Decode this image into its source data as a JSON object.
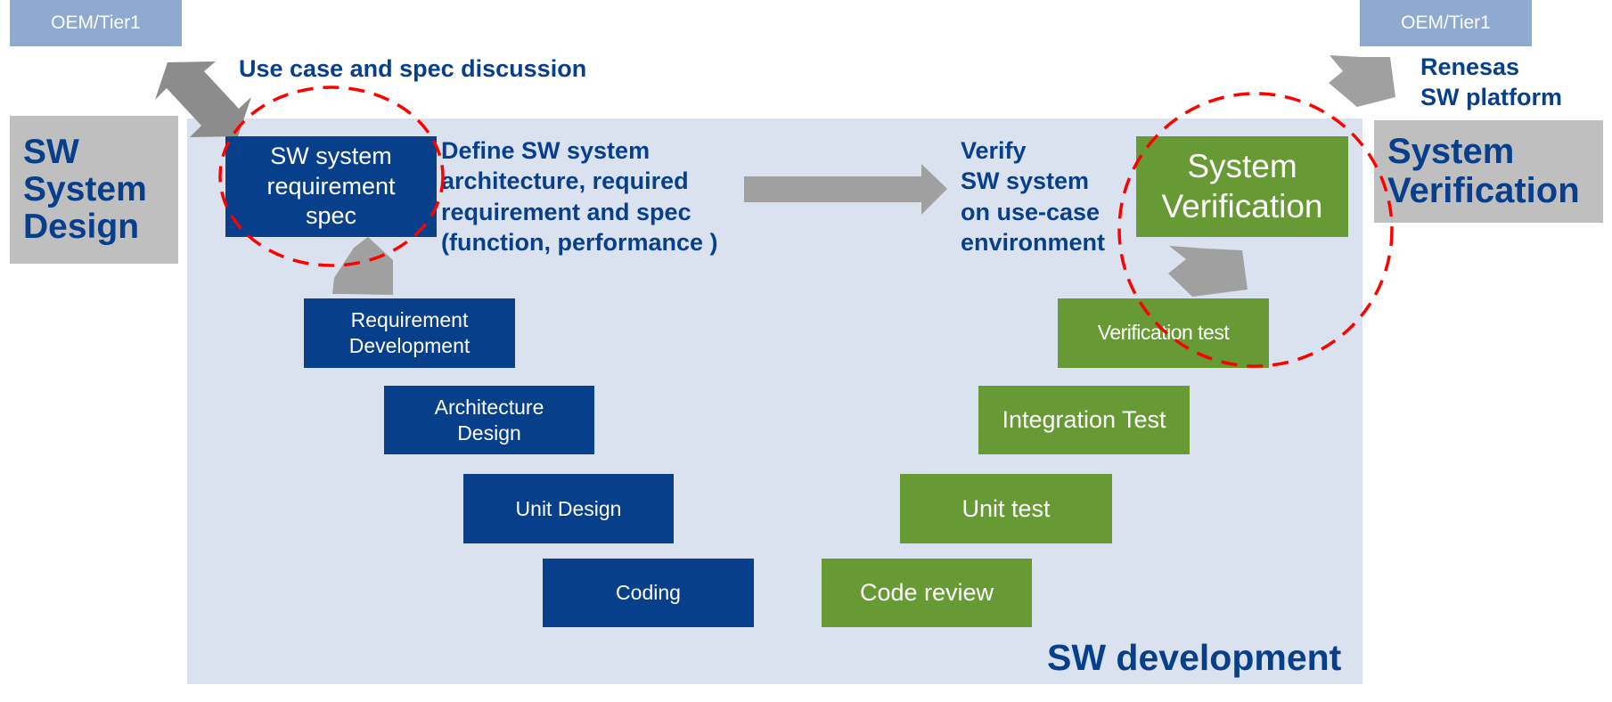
{
  "external": {
    "left_party": "OEM/Tier1",
    "right_party": "OEM/Tier1"
  },
  "phases": {
    "design": [
      "SW",
      "System",
      "Design"
    ],
    "verification": [
      "System",
      "Verification"
    ]
  },
  "captions": {
    "use_case": "Use case and spec discussion",
    "renesas": [
      "Renesas",
      "SW platform"
    ],
    "define": [
      "Define SW system",
      "architecture, required",
      "requirement and spec",
      "(function, performance )"
    ],
    "verify": [
      "Verify",
      "SW system",
      "on use-case",
      "environment"
    ],
    "panel_title": "SW development"
  },
  "left_steps": [
    {
      "lines": [
        "SW system",
        "requirement",
        "spec"
      ]
    },
    {
      "lines": [
        "Requirement",
        "Development"
      ]
    },
    {
      "lines": [
        "Architecture",
        "Design"
      ]
    },
    {
      "lines": [
        "Unit Design"
      ]
    },
    {
      "lines": [
        "Coding"
      ]
    }
  ],
  "right_steps": [
    {
      "lines": [
        "Code review"
      ]
    },
    {
      "lines": [
        "Unit test"
      ]
    },
    {
      "lines": [
        "Integration Test"
      ]
    },
    {
      "lines": [
        "Verification test"
      ]
    },
    {
      "lines": [
        "System",
        "Verification"
      ]
    }
  ],
  "colors": {
    "design_blue": "#073f8a",
    "verify_green": "#679935",
    "panel_bg": "#d9e2ee",
    "oem_bg": "#8eaad1",
    "phase_gray": "#bfbfbf",
    "highlight_red": "#ff0000",
    "arrow_gray": "#a0a0a0"
  }
}
